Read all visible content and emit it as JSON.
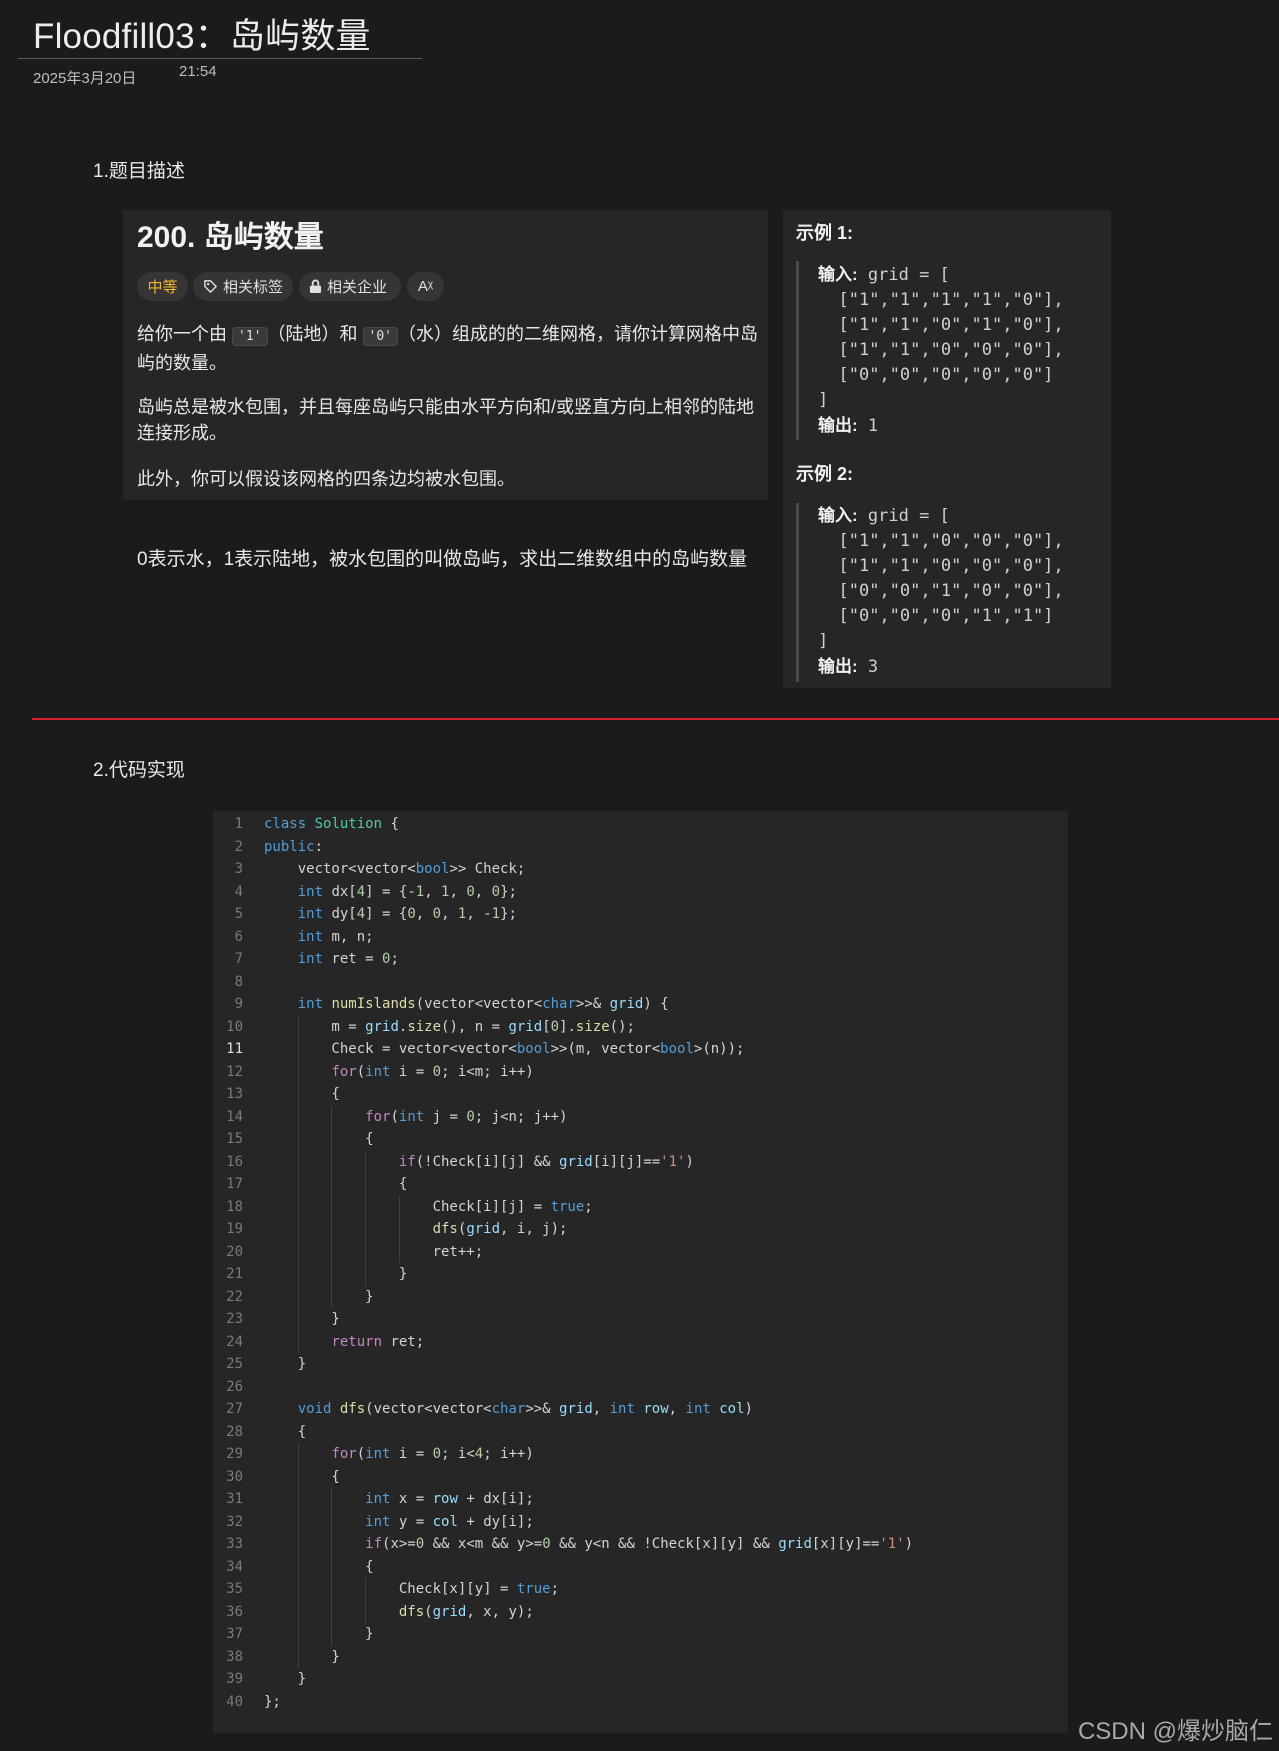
{
  "note": {
    "title": "Floodfill03：岛屿数量",
    "date": "2025年3月20日",
    "time": "21:54"
  },
  "section1": {
    "heading": "1.题目描述"
  },
  "problem": {
    "title": "200. 岛屿数量",
    "tags": {
      "difficulty": "中等",
      "topics": "相关标签",
      "companies": "相关企业",
      "translate": "Aᵡ"
    },
    "para1": {
      "before": "给你一个由 ",
      "code1": "'1'",
      "mid": "（陆地）和 ",
      "code2": "'0'",
      "after": "（水）组成的的二维网格，请你计算网格中岛屿的数量。"
    },
    "para2": "岛屿总是被水包围，并且每座岛屿只能由水平方向和/或竖直方向上相邻的陆地连接形成。",
    "para3": "此外，你可以假设该网格的四条边均被水包围。"
  },
  "note_text": "0表示水，1表示陆地，被水包围的叫做岛屿，求出二维数组中的岛屿数量",
  "examples": [
    {
      "title": "示例 1:",
      "input_label": "输入:",
      "input_head": " grid = [",
      "rows": [
        "[\"1\",\"1\",\"1\",\"1\",\"0\"],",
        "[\"1\",\"1\",\"0\",\"1\",\"0\"],",
        "[\"1\",\"1\",\"0\",\"0\",\"0\"],",
        "[\"0\",\"0\",\"0\",\"0\",\"0\"]"
      ],
      "close": "]",
      "output_label": "输出:",
      "output_value": " 1"
    },
    {
      "title": "示例 2:",
      "input_label": "输入:",
      "input_head": " grid = [",
      "rows": [
        "[\"1\",\"1\",\"0\",\"0\",\"0\"],",
        "[\"1\",\"1\",\"0\",\"0\",\"0\"],",
        "[\"0\",\"0\",\"1\",\"0\",\"0\"],",
        "[\"0\",\"0\",\"0\",\"1\",\"1\"]"
      ],
      "close": "]",
      "output_label": "输出:",
      "output_value": " 3"
    }
  ],
  "section2": {
    "heading": "2.代码实现"
  },
  "code": {
    "active_line": 11,
    "lines": [
      "class Solution {",
      "public:",
      "    vector<vector<bool>> Check;",
      "    int dx[4] = {-1, 1, 0, 0};",
      "    int dy[4] = {0, 0, 1, -1};",
      "    int m, n;",
      "    int ret = 0;",
      "",
      "    int numIslands(vector<vector<char>>& grid) {",
      "        m = grid.size(), n = grid[0].size();",
      "        Check = vector<vector<bool>>(m, vector<bool>(n));",
      "        for(int i = 0; i<m; i++)",
      "        {",
      "            for(int j = 0; j<n; j++)",
      "            {",
      "                if(!Check[i][j] && grid[i][j]=='1')",
      "                {",
      "                    Check[i][j] = true;",
      "                    dfs(grid, i, j);",
      "                    ret++;",
      "                }",
      "            }",
      "        }",
      "        return ret;",
      "    }",
      "",
      "    void dfs(vector<vector<char>>& grid, int row, int col)",
      "    {",
      "        for(int i = 0; i<4; i++)",
      "        {",
      "            int x = row + dx[i];",
      "            int y = col + dy[i];",
      "            if(x>=0 && x<m && y>=0 && y<n && !Check[x][y] && grid[x][y]=='1')",
      "            {",
      "                Check[x][y] = true;",
      "                dfs(grid, x, y);",
      "            }",
      "        }",
      "    }",
      "};"
    ]
  },
  "watermark": "CSDN @爆炒脑仁"
}
